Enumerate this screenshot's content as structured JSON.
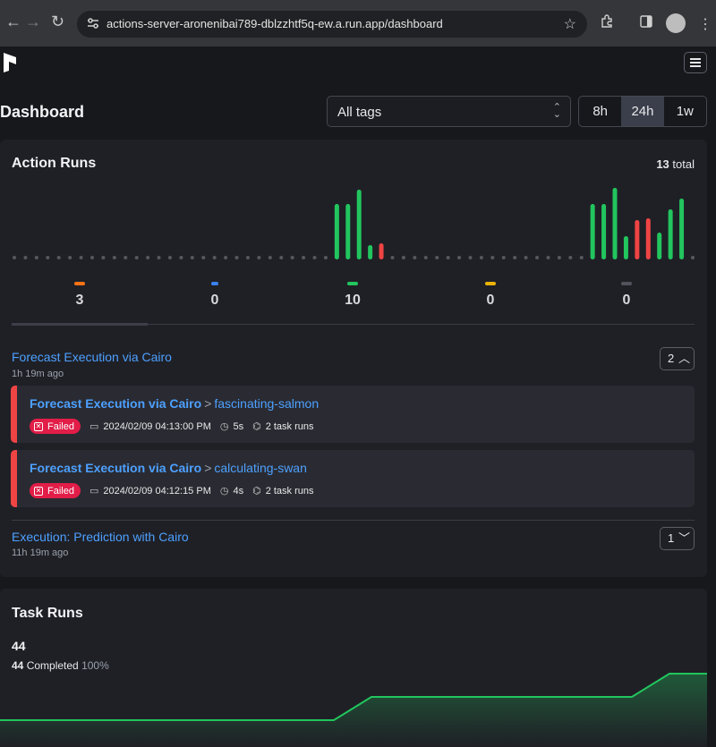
{
  "browser": {
    "url": "actions-server-aronenibai789-dblzzhtf5q-ew.a.run.app/dashboard"
  },
  "page": {
    "title": "Dashboard",
    "tag_filter": "All tags",
    "time_ranges": [
      "8h",
      "24h",
      "1w"
    ],
    "selected_range": "24h"
  },
  "action_runs": {
    "title": "Action Runs",
    "total_count": "13",
    "total_suffix": "total",
    "chart_data": {
      "type": "bar",
      "x_slots": 60,
      "series": [
        {
          "color": "#22c55e",
          "values": [
            [
              29,
              62
            ],
            [
              30,
              62
            ],
            [
              31,
              78
            ]
          ]
        },
        {
          "color": "#22c55e",
          "values": [
            [
              32,
              16
            ]
          ]
        },
        {
          "color": "#ef4444",
          "values": [
            [
              33,
              18
            ]
          ]
        },
        {
          "color": "#22c55e",
          "values": [
            [
              52,
              62
            ],
            [
              53,
              62
            ],
            [
              54,
              80
            ],
            [
              55,
              26
            ]
          ]
        },
        {
          "color": "#ef4444",
          "values": [
            [
              56,
              44
            ],
            [
              57,
              46
            ]
          ]
        },
        {
          "color": "#22c55e",
          "values": [
            [
              58,
              30
            ],
            [
              59,
              56
            ],
            [
              60,
              68
            ]
          ]
        }
      ]
    },
    "states": [
      {
        "color": "#f97316",
        "count": "3"
      },
      {
        "color": "#3b82f6",
        "count": "0"
      },
      {
        "color": "#22c55e",
        "count": "10"
      },
      {
        "color": "#eab308",
        "count": "0"
      },
      {
        "color": "#52525b",
        "count": "0"
      }
    ],
    "groups": [
      {
        "name": "Forecast Execution via Cairo",
        "ago": "1h 19m ago",
        "count": "2",
        "runs": [
          {
            "flow": "Forecast Execution via Cairo",
            "sep": ">",
            "name": "fascinating-salmon",
            "state": "Failed",
            "date": "2024/02/09 04:13:00 PM",
            "duration": "5s",
            "tasks": "2 task runs"
          },
          {
            "flow": "Forecast Execution via Cairo",
            "sep": ">",
            "name": "calculating-swan",
            "state": "Failed",
            "date": "2024/02/09 04:12:15 PM",
            "duration": "4s",
            "tasks": "2 task runs"
          }
        ]
      },
      {
        "name": "Execution: Prediction with Cairo",
        "ago": "11h 19m ago",
        "count": "1"
      }
    ]
  },
  "task_runs": {
    "title": "Task Runs",
    "count": "44",
    "completed_count": "44",
    "completed_label": "Completed",
    "completed_pct": "100%",
    "chart_data": {
      "type": "area",
      "x": [
        0,
        1,
        2,
        3,
        4,
        5
      ],
      "y": [
        0,
        0,
        1,
        1,
        2,
        2
      ],
      "color": "#22c55e"
    }
  }
}
